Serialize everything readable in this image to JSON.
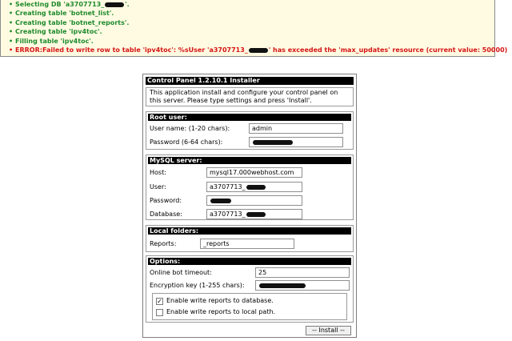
{
  "log": [
    {
      "type": "ok",
      "prefix": "Selecting DB 'a3707713_",
      "suffix": "'."
    },
    {
      "type": "ok",
      "text": "Creating table 'botnet_list'."
    },
    {
      "type": "ok",
      "text": "Creating table 'botnet_reports'."
    },
    {
      "type": "ok",
      "text": "Creating table 'ipv4toc'."
    },
    {
      "type": "ok",
      "text": "Filling table 'ipv4toc'."
    },
    {
      "type": "err",
      "prefix": "ERROR:Failed to write row to table 'ipv4toc': %sUser 'a3707713_",
      "suffix": "' has exceeded the 'max_updates' resource (current value: 50000)"
    }
  ],
  "colors": {
    "ok": "#1f8b2e",
    "err": "#d61414",
    "log_bg": "#fffbe2"
  },
  "installer": {
    "title": "Control Panel 1.2.10.1 Installer",
    "intro_line1": "This application install and configure your control panel on",
    "intro_line2": "this server. Please type settings and press 'Install'.",
    "root": {
      "title": "Root user:",
      "username_label": "User name: (1-20 chars):",
      "username_value": "admin",
      "password_label": "Password (6-64 chars):"
    },
    "mysql": {
      "title": "MySQL server:",
      "host_label": "Host:",
      "host_value": "mysql17.000webhost.com",
      "user_label": "User:",
      "user_value_prefix": "a3707713_",
      "password_label": "Password:",
      "database_label": "Database:",
      "database_value_prefix": "a3707713_"
    },
    "local": {
      "title": "Local folders:",
      "reports_label": "Reports:",
      "reports_value": "_reports"
    },
    "options": {
      "title": "Options:",
      "timeout_label": "Online bot timeout:",
      "timeout_value": "25",
      "enc_label": "Encryption key (1-255 chars):",
      "cb_db_label": "Enable write reports to database.",
      "cb_db_checked": true,
      "cb_local_label": "Enable write reports to local path.",
      "cb_local_checked": false
    },
    "install_button": "-- Install --"
  }
}
